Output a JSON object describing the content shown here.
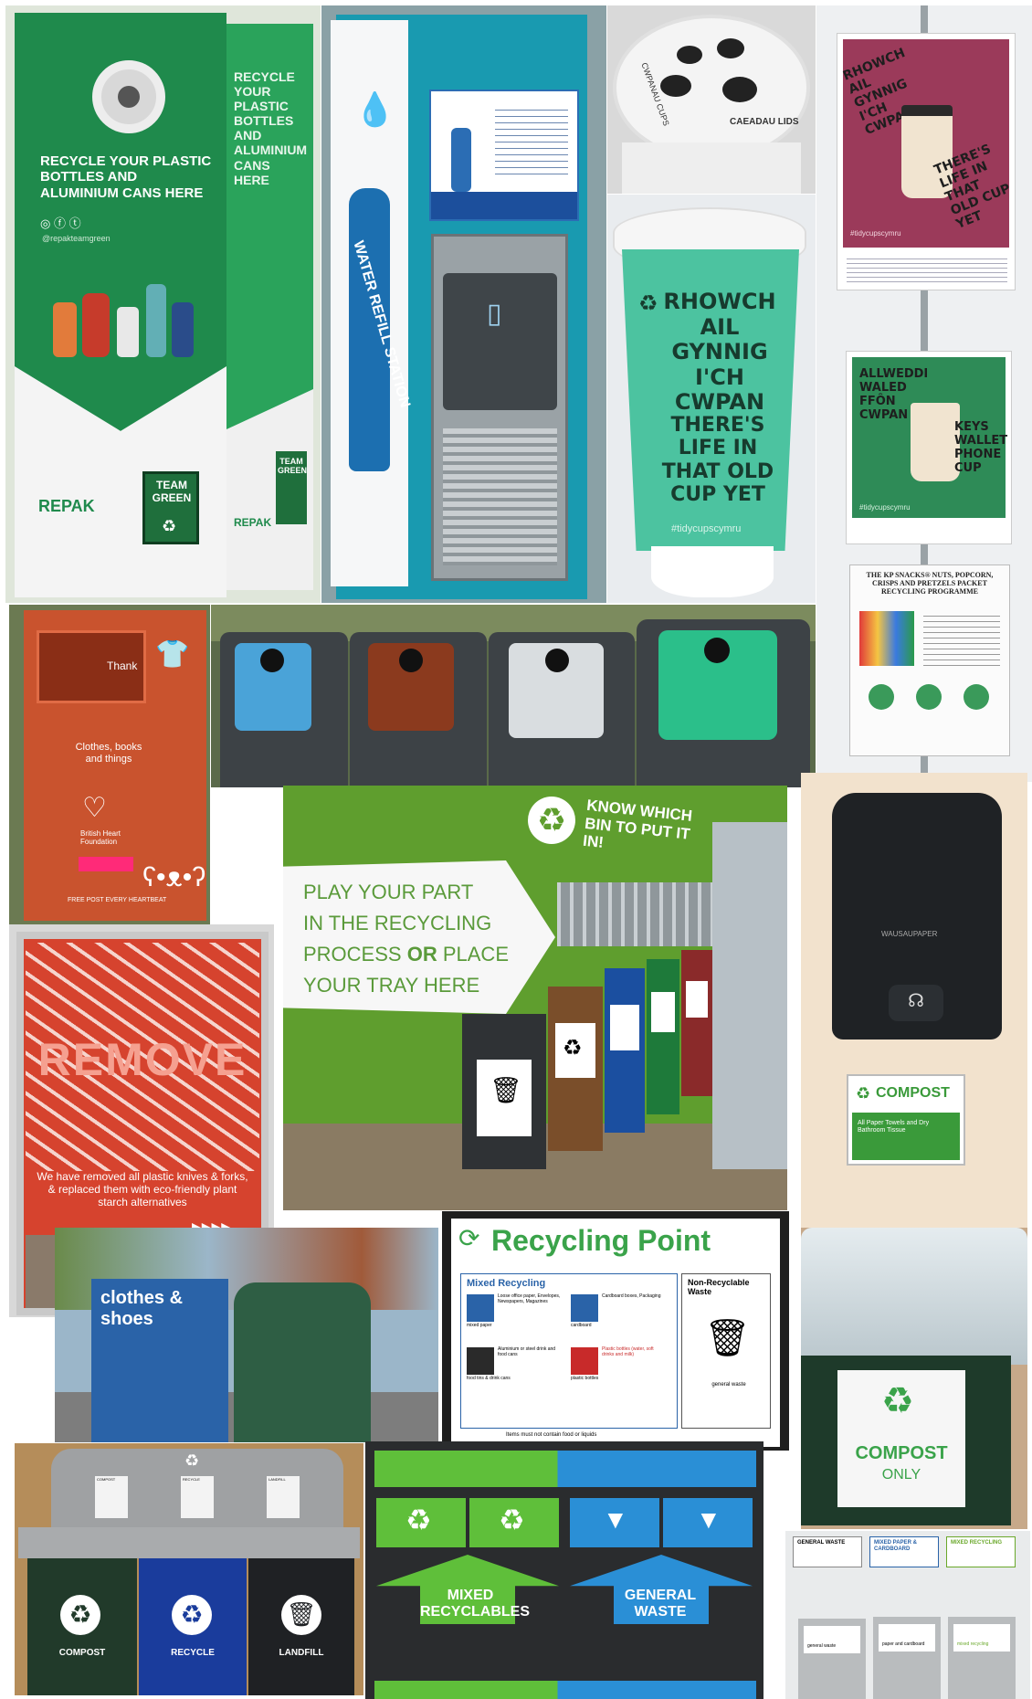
{
  "repak": {
    "front_text": "RECYCLE YOUR PLASTIC BOTTLES AND ALUMINIUM CANS HERE",
    "side_text": "RECYCLE YOUR PLASTIC BOTTLES AND ALUMINIUM CANS HERE",
    "handle": "@repakteamgreen",
    "logo": "REPAK",
    "logo_side": "REPAK",
    "badge": "TEAM GREEN",
    "badge_side": "TEAM GREEN"
  },
  "water_station": {
    "vertical_text": "WATER REFILL STATION",
    "bottle_label": "WATER REFILL STATION"
  },
  "cup_lid": {
    "label1": "CWPANAU CUPS",
    "label2": "CAEADAU LIDS"
  },
  "cup_bin": {
    "welsh": "RHOWCH AIL GYNNIG I'CH CWPAN",
    "english": "THERE'S LIFE IN THAT OLD CUP YET",
    "hashtag": "#tidycupscymru"
  },
  "poster_top": {
    "welsh": "RHOWCH AIL GYNNIG I'CH CWPAN",
    "english": "THERE'S LIFE IN THAT OLD CUP YET",
    "hashtag": "#tidycupscymru",
    "bg": "#9b3a5a"
  },
  "poster_mid": {
    "welsh": "ALLWEDDI WALED FFÔN CWPAN",
    "english": "KEYS WALLET PHONE CUP",
    "hashtag": "#tidycupscymru",
    "bg": "#2e8b57"
  },
  "kp_notice": {
    "title": "THE KP SNACKS® NUTS, POPCORN, CRISPS AND PRETZELS PACKET RECYCLING PROGRAMME"
  },
  "bhf_bank": {
    "thank": "Thank",
    "text": "Clothes, books and things",
    "org": "British Heart Foundation",
    "footer": "FREE POST EVERY HEARTBEAT"
  },
  "glass_bins": {
    "items": [
      {
        "color": "#4aa3d8"
      },
      {
        "color": "#8b3a1e"
      },
      {
        "color": "#d9dde0"
      },
      {
        "color": "#2bbf8a"
      }
    ]
  },
  "canteen": {
    "wall_sign": "KNOW WHICH BIN TO PUT IT IN!",
    "arrow_line1": "PLAY YOUR PART",
    "arrow_line2": "IN THE RECYCLING",
    "arrow_line3a": "PROCESS",
    "arrow_line3b": "OR",
    "arrow_line3c": "PLACE",
    "arrow_line4": "YOUR TRAY HERE"
  },
  "dispenser": {
    "brand": "WAUSAUPAPER",
    "compost_label": "COMPOST",
    "compost_sub": "All Paper Towels and Dry Bathroom Tissue"
  },
  "remove_poster": {
    "headline": "REMOVE",
    "body": "We have removed all plastic knives & forks, & replaced them with eco-friendly plant starch alternatives"
  },
  "street_bank": {
    "label": "clothes & shoes"
  },
  "recycling_point": {
    "title": "Recycling Point",
    "mixed": "Mixed Recycling",
    "non_recyclable": "Non-Recyclable Waste",
    "paper_list": "Loose office paper, Envelopes, Newspapers, Magazines",
    "paper_label": "mixed paper",
    "cardboard_list": "Cardboard boxes, Packaging",
    "cardboard_label": "cardboard",
    "cans_list": "Aluminium or steel drink and food cans",
    "cans_label": "food tins & drink cans",
    "plastic_list": "Plastic bottles (water, soft drinks and milk)",
    "plastic_label": "plastic bottles",
    "general": "general waste",
    "footer": "Items must not contain food or liquids"
  },
  "compost_bin": {
    "label": "COMPOST",
    "only": "ONLY"
  },
  "three_bins": {
    "compost": "COMPOST",
    "recycle": "RECYCLE",
    "landfill": "LANDFILL",
    "sign_left": "COMPOST",
    "sign_mid": "RECYCLE",
    "sign_right": "LANDFILL"
  },
  "floor_bins": {
    "mixed": "MIXED RECYCLABLES",
    "general": "GENERAL WASTE"
  },
  "small_bins": {
    "left": "GENERAL WASTE",
    "mid": "MIXED PAPER & CARDBOARD",
    "right": "MIXED RECYCLING",
    "bin_left": "general waste",
    "bin_mid": "paper and cardboard",
    "bin_right": "mixed recycling"
  }
}
